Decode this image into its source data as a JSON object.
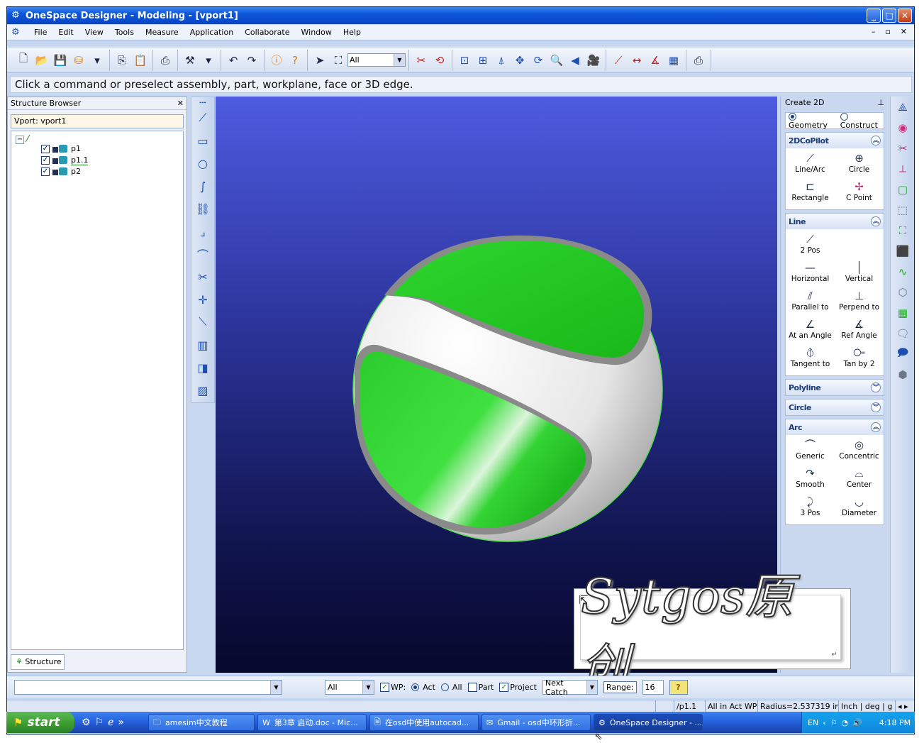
{
  "window": {
    "title": "OneSpace Designer - Modeling - [vport1]",
    "controls": [
      "_",
      "□",
      "✕"
    ]
  },
  "menubar": {
    "items": [
      "File",
      "Edit",
      "View",
      "Tools",
      "Measure",
      "Application",
      "Collaborate",
      "Window",
      "Help"
    ],
    "mdi_controls": [
      "–",
      "▫",
      "✕"
    ]
  },
  "toolbar": {
    "filter_value": "All"
  },
  "prompt": "Click a command or preselect assembly, part, workplane, face or 3D edge.",
  "structure_browser": {
    "title": "Structure Browser",
    "close": "✕",
    "vport_label": "Vport: vport1",
    "items": [
      "p1",
      "p1.1",
      "p2"
    ],
    "tab": "Structure"
  },
  "create2d": {
    "title": "Create 2D",
    "pin": "⊥",
    "mode_geometry": "Geometry",
    "mode_construct": "Construct",
    "sections": {
      "copilot": {
        "title": "2DCoPilot",
        "items": [
          "Line/Arc",
          "Circle",
          "Rectangle",
          "C Point"
        ]
      },
      "line": {
        "title": "Line",
        "items": [
          "2 Pos",
          "Horizontal",
          "Vertical",
          "Parallel to",
          "Perpend to",
          "At an Angle",
          "Ref Angle",
          "Tangent to",
          "Tan by 2"
        ]
      },
      "polyline": {
        "title": "Polyline"
      },
      "circle": {
        "title": "Circle"
      },
      "arc": {
        "title": "Arc",
        "items": [
          "Generic",
          "Concentric",
          "Smooth",
          "Center",
          "3 Pos",
          "Diameter"
        ]
      }
    }
  },
  "watermark": {
    "text": "Sytgos原创"
  },
  "bottombar": {
    "filter_value": "All",
    "wp_label": "WP:",
    "act_label": "Act",
    "all_label": "All",
    "part_label": "Part",
    "project_label": "Project",
    "catch_value": "Next Catch",
    "range_label": "Range:",
    "range_value": "16",
    "help": "?"
  },
  "statusbar": {
    "path": "/p1.1",
    "wp_status": "All in Act WP",
    "radius": "Radius=2.537319 in",
    "units": "Inch | deg | g"
  },
  "taskbar": {
    "start": "start",
    "tasks": [
      "amesim中文教程",
      "第3章 启动.doc - Mic...",
      "在osd中使用autocad...",
      "Gmail - osd中环形折...",
      "OneSpace Designer - ..."
    ],
    "lang": "EN",
    "time": "4:18 PM"
  },
  "colors": {
    "viewport_top": "#4d5be0",
    "viewport_bottom": "#06082c",
    "ball_green": "#2fd32f",
    "ball_white": "#f2f2f2",
    "accent_blue": "#1d4fb1"
  }
}
